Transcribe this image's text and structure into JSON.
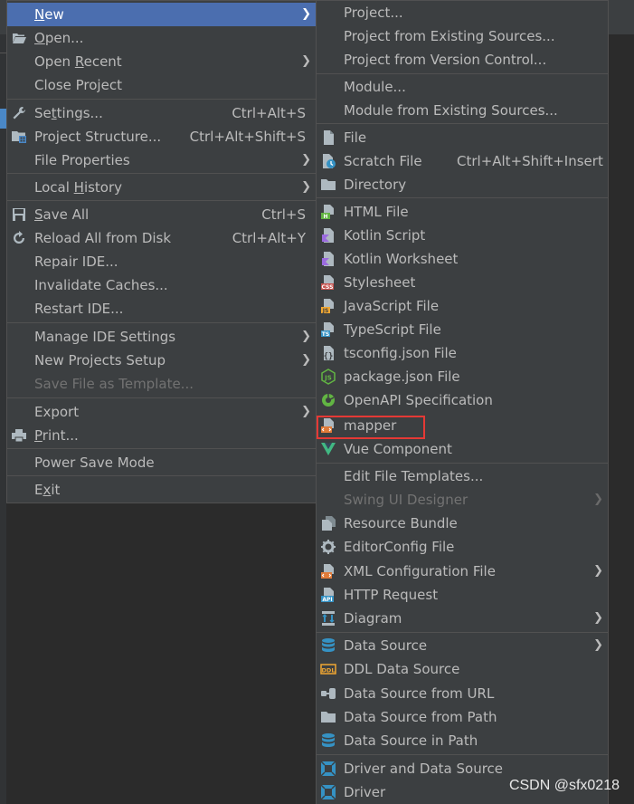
{
  "main_menu": {
    "items": [
      {
        "label": "New",
        "mnemonic": "N",
        "has_submenu": true,
        "selected": true
      },
      {
        "label": "Open...",
        "mnemonic": "O"
      },
      {
        "label": "Open Recent",
        "mnemonic": "R",
        "has_submenu": true
      },
      {
        "label": "Close Project"
      },
      {
        "label": "Settings...",
        "mnemonic": "t",
        "shortcut": "Ctrl+Alt+S"
      },
      {
        "label": "Project Structure...",
        "shortcut": "Ctrl+Alt+Shift+S"
      },
      {
        "label": "File Properties",
        "has_submenu": true
      },
      {
        "label": "Local History",
        "mnemonic": "H",
        "has_submenu": true
      },
      {
        "label": "Save All",
        "mnemonic": "S",
        "shortcut": "Ctrl+S"
      },
      {
        "label": "Reload All from Disk",
        "shortcut": "Ctrl+Alt+Y"
      },
      {
        "label": "Repair IDE..."
      },
      {
        "label": "Invalidate Caches..."
      },
      {
        "label": "Restart IDE..."
      },
      {
        "label": "Manage IDE Settings",
        "has_submenu": true
      },
      {
        "label": "New Projects Setup",
        "has_submenu": true
      },
      {
        "label": "Save File as Template...",
        "disabled": true
      },
      {
        "label": "Export",
        "has_submenu": true
      },
      {
        "label": "Print...",
        "mnemonic": "P"
      },
      {
        "label": "Power Save Mode"
      },
      {
        "label": "Exit",
        "mnemonic": "x"
      }
    ]
  },
  "new_submenu": {
    "items": [
      {
        "label": "Project..."
      },
      {
        "label": "Project from Existing Sources..."
      },
      {
        "label": "Project from Version Control..."
      },
      {
        "label": "Module..."
      },
      {
        "label": "Module from Existing Sources..."
      },
      {
        "label": "File",
        "icon": "file-icon"
      },
      {
        "label": "Scratch File",
        "icon": "scratch-file-icon",
        "shortcut": "Ctrl+Alt+Shift+Insert"
      },
      {
        "label": "Directory",
        "icon": "folder-icon"
      },
      {
        "label": "HTML File",
        "icon": "html-file-icon"
      },
      {
        "label": "Kotlin Script",
        "icon": "kotlin-script-icon"
      },
      {
        "label": "Kotlin Worksheet",
        "icon": "kotlin-worksheet-icon"
      },
      {
        "label": "Stylesheet",
        "icon": "css-file-icon"
      },
      {
        "label": "JavaScript File",
        "icon": "js-file-icon"
      },
      {
        "label": "TypeScript File",
        "icon": "ts-file-icon"
      },
      {
        "label": "tsconfig.json File",
        "icon": "tsconfig-file-icon"
      },
      {
        "label": "package.json File",
        "icon": "nodejs-icon"
      },
      {
        "label": "OpenAPI Specification",
        "icon": "openapi-icon"
      },
      {
        "label": "mapper",
        "icon": "xml-template-icon",
        "highlighted": true
      },
      {
        "label": "Vue  Component",
        "icon": "vue-icon"
      },
      {
        "label": "Edit File Templates..."
      },
      {
        "label": "Swing UI Designer",
        "disabled": true,
        "has_submenu": true
      },
      {
        "label": "Resource Bundle",
        "icon": "resource-bundle-icon"
      },
      {
        "label": "EditorConfig File",
        "icon": "editorconfig-icon"
      },
      {
        "label": "XML Configuration File",
        "icon": "xml-config-icon",
        "has_submenu": true
      },
      {
        "label": "HTTP Request",
        "icon": "api-icon"
      },
      {
        "label": "Diagram",
        "icon": "diagram-icon",
        "has_submenu": true
      },
      {
        "label": "Data Source",
        "icon": "database-icon",
        "has_submenu": true
      },
      {
        "label": "DDL Data Source",
        "icon": "ddl-icon"
      },
      {
        "label": "Data Source from URL",
        "icon": "url-datasource-icon"
      },
      {
        "label": "Data Source from Path",
        "icon": "folder-datasource-icon"
      },
      {
        "label": "Data Source in Path",
        "icon": "database-path-icon"
      },
      {
        "label": "Driver and Data Source",
        "icon": "driver-datasource-icon"
      },
      {
        "label": "Driver",
        "icon": "driver-icon"
      }
    ]
  },
  "watermark": "CSDN @sfx0218",
  "colors": {
    "menu_bg": "#3c3f41",
    "selected_bg": "#4b6eaf",
    "text": "#bbbbbb",
    "disabled_text": "#727272",
    "highlight_border": "#e53935"
  }
}
